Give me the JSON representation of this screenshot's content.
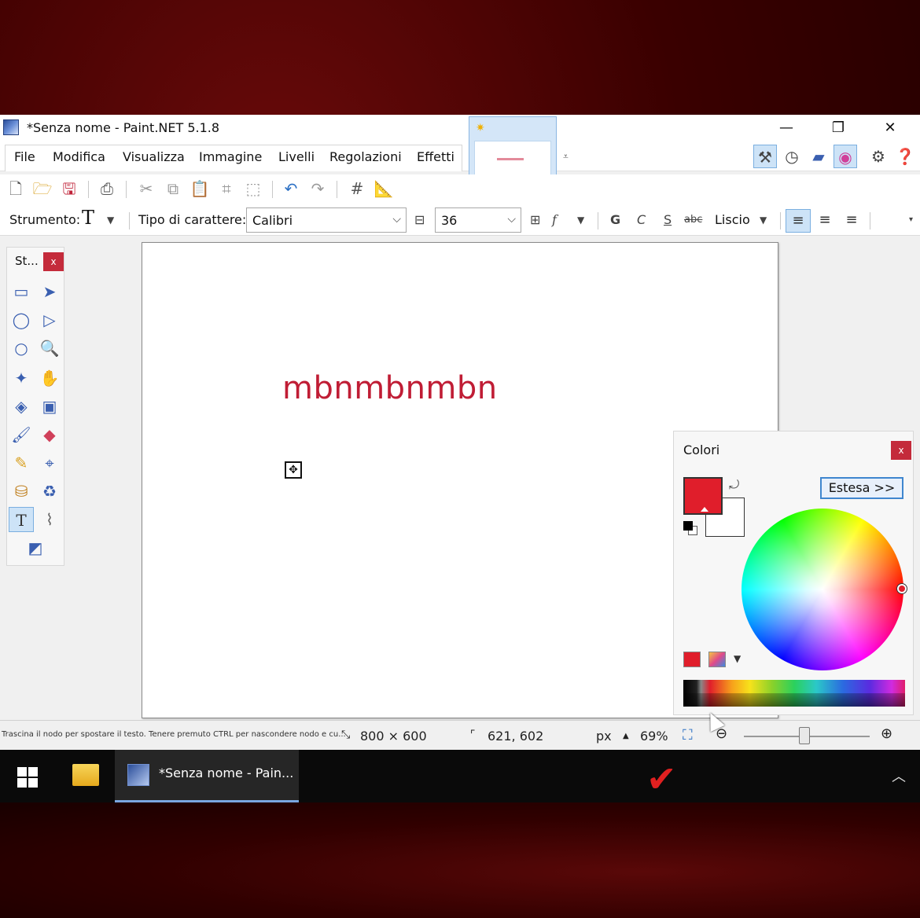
{
  "window": {
    "title": "*Senza nome - Paint.NET 5.1.8",
    "minimize": "—",
    "restore": "❐",
    "close": "✕"
  },
  "menu": {
    "items": [
      "File",
      "Modifica",
      "Visualizza",
      "Immagine",
      "Livelli",
      "Regolazioni",
      "Effetti"
    ]
  },
  "toolbar": {
    "tool_label": "Strumento:",
    "tool_glyph": "T",
    "font_label": "Tipo di carattere:",
    "font_value": "Calibri",
    "size_value": "36",
    "bold": "G",
    "italic": "C",
    "underline": "S",
    "strike": "abc",
    "antialias": "Liscio"
  },
  "tools_panel": {
    "title": "St...",
    "close": "x"
  },
  "canvas": {
    "text": "mbnmbnmbn"
  },
  "colors_panel": {
    "title": "Colori",
    "close": "x",
    "expand_button": "Estesa >>",
    "primary_color": "#e01e2b",
    "secondary_color": "#ffffff"
  },
  "status": {
    "hint": "Trascina il nodo per spostare il testo. Tenere premuto CTRL per nascondere nodo e cu...",
    "image_size": "800 × 600",
    "cursor_pos": "621, 602",
    "units": "px",
    "zoom": "69%"
  },
  "taskbar": {
    "task_label": "*Senza nome - Pain..."
  }
}
